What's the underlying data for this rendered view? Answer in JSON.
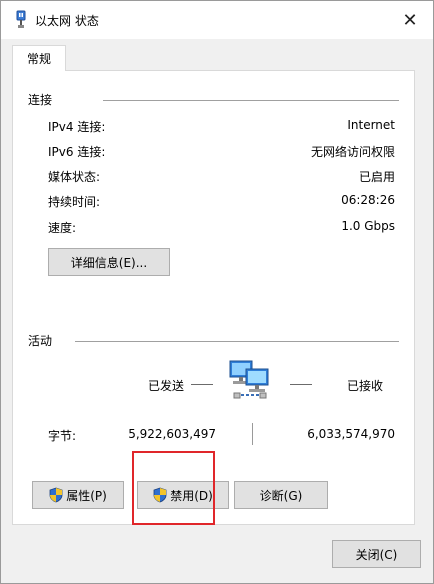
{
  "window": {
    "title": "以太网 状态",
    "close_label": "✕"
  },
  "tabs": [
    {
      "label": "常规"
    }
  ],
  "connection": {
    "section_title": "连接",
    "rows": [
      {
        "label": "IPv4 连接:",
        "value": "Internet"
      },
      {
        "label": "IPv6 连接:",
        "value": "无网络访问权限"
      },
      {
        "label": "媒体状态:",
        "value": "已启用"
      },
      {
        "label": "持续时间:",
        "value": "06:28:26"
      },
      {
        "label": "速度:",
        "value": "1.0 Gbps"
      }
    ],
    "details_button": "详细信息(E)..."
  },
  "activity": {
    "section_title": "活动",
    "sent_label": "已发送",
    "received_label": "已接收",
    "bytes_label": "字节:",
    "bytes_sent": "5,922,603,497",
    "bytes_received": "6,033,574,970",
    "icon": "network-computers-icon"
  },
  "actions": {
    "properties_button": "属性(P)",
    "disable_button": "禁用(D)",
    "diagnose_button": "诊断(G)",
    "highlighted": "disable_button",
    "highlight_color": "#e0262a"
  },
  "footer": {
    "close_button": "关闭(C)"
  },
  "colors": {
    "window_bg": "#f0f0f0",
    "panel_bg": "#ffffff",
    "button_bg": "#e1e1e1",
    "button_border": "#adadad"
  }
}
